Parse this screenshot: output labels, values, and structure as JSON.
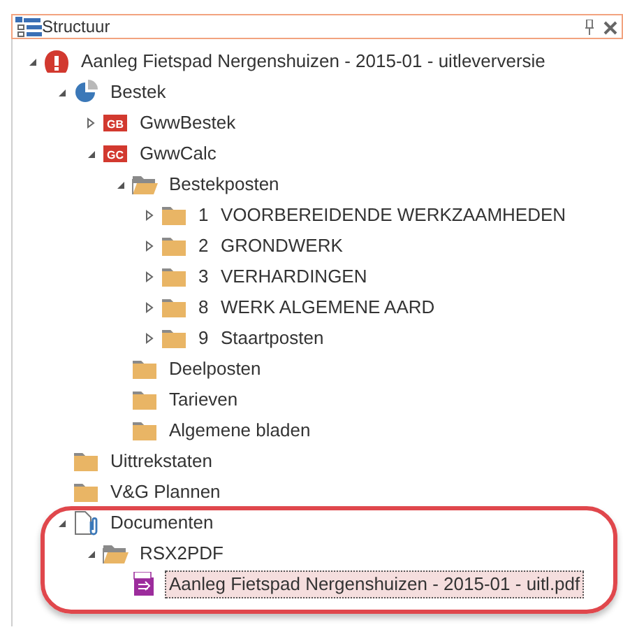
{
  "panel": {
    "title": "Structuur"
  },
  "tree": [
    {
      "label": "Aanleg Fietspad Nergenshuizen - 2015-01 - uitleverversie",
      "kind": "app",
      "expanded": true,
      "selected": false,
      "children": [
        {
          "label": "Bestek",
          "kind": "pie",
          "expanded": true,
          "selected": false,
          "children": [
            {
              "label": "GwwBestek",
              "kind": "badge",
              "badge": "GB",
              "expanded": false,
              "selected": false
            },
            {
              "label": "GwwCalc",
              "kind": "badge",
              "badge": "GC",
              "expanded": true,
              "selected": false,
              "children": [
                {
                  "label": "Bestekposten",
                  "kind": "folder-open",
                  "expanded": true,
                  "selected": false,
                  "children": [
                    {
                      "number": "1",
                      "label": "VOORBEREIDENDE WERKZAAMHEDEN",
                      "kind": "folder",
                      "expanded": false,
                      "selected": false
                    },
                    {
                      "number": "2",
                      "label": "GRONDWERK",
                      "kind": "folder",
                      "expanded": false,
                      "selected": false
                    },
                    {
                      "number": "3",
                      "label": "VERHARDINGEN",
                      "kind": "folder",
                      "expanded": false,
                      "selected": false
                    },
                    {
                      "number": "8",
                      "label": "WERK ALGEMENE AARD",
                      "kind": "folder",
                      "expanded": false,
                      "selected": false
                    },
                    {
                      "number": "9",
                      "label": "Staartposten",
                      "kind": "folder",
                      "expanded": false,
                      "selected": false
                    }
                  ]
                },
                {
                  "label": "Deelposten",
                  "kind": "folder",
                  "selected": false
                },
                {
                  "label": "Tarieven",
                  "kind": "folder",
                  "selected": false
                },
                {
                  "label": "Algemene bladen",
                  "kind": "folder",
                  "selected": false
                }
              ]
            }
          ]
        },
        {
          "label": "Uittrekstaten",
          "kind": "folder",
          "selected": false
        },
        {
          "label": "V&G Plannen",
          "kind": "folder",
          "selected": false
        },
        {
          "label": "Documenten",
          "kind": "documents",
          "expanded": true,
          "selected": false,
          "circled": true,
          "children": [
            {
              "label": "RSX2PDF",
              "kind": "folder-open",
              "expanded": true,
              "selected": false,
              "children": [
                {
                  "label": "Aanleg Fietspad Nergenshuizen - 2015-01 - uitl.pdf",
                  "kind": "pdf",
                  "selected": true
                }
              ]
            }
          ]
        }
      ]
    }
  ]
}
